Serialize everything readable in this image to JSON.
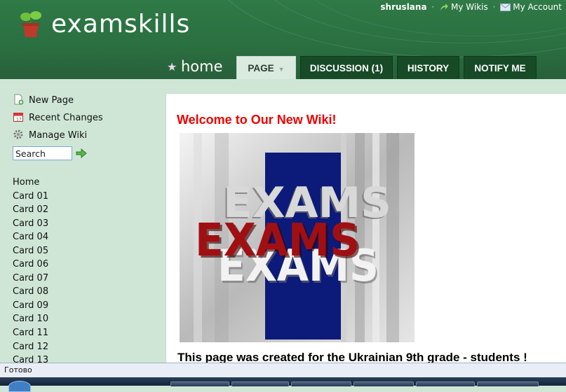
{
  "site": {
    "title": "examskills"
  },
  "user_nav": {
    "username": "shruslana",
    "my_wikis": "My Wikis",
    "my_account": "My Account"
  },
  "page": {
    "home_label": "home",
    "tabs": [
      {
        "label": "PAGE",
        "active": true
      },
      {
        "label": "DISCUSSION (1)",
        "active": false
      },
      {
        "label": "HISTORY",
        "active": false
      },
      {
        "label": "NOTIFY ME",
        "active": false
      }
    ]
  },
  "sidebar": {
    "actions": [
      {
        "label": "New Page",
        "icon": "new-page-icon"
      },
      {
        "label": "Recent Changes",
        "icon": "calendar-icon"
      },
      {
        "label": "Manage Wiki",
        "icon": "gear-icon"
      }
    ],
    "search_value": "Search",
    "nav": [
      "Home",
      "Card 01",
      "Card 02",
      "Card 03",
      "Card 04",
      "Card 05",
      "Card 06",
      "Card 07",
      "Card 08",
      "Card 09",
      "Card 10",
      "Card 11",
      "Card 12",
      "Card 13"
    ]
  },
  "content": {
    "heading": "Welcome to Our New Wiki!",
    "image_words": [
      "EXAMS",
      "EXAMS",
      "EXAMS"
    ],
    "intro": "This page was created for the Ukrainian 9th grade - students !"
  },
  "status": {
    "text": "Готово"
  },
  "colors": {
    "header_green": "#2f7a47",
    "tab_dark": "#174a26",
    "heading_red": "#e00000",
    "sidebar_bg": "#cfe6d6"
  }
}
